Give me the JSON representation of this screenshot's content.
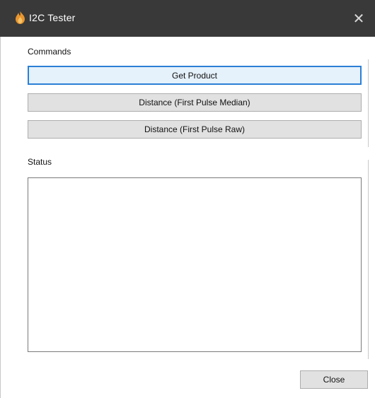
{
  "window": {
    "title": "I2C Tester",
    "close_glyph": "✕",
    "icon": "orange-flame-icon",
    "titlebar_color": "#393939"
  },
  "commands": {
    "label": "Commands",
    "buttons": [
      {
        "label": "Get Product"
      },
      {
        "label": "Distance (First Pulse Median)"
      },
      {
        "label": "Distance (First Pulse Raw)"
      }
    ],
    "focused_index": 0
  },
  "status": {
    "label": "Status",
    "text": ""
  },
  "footer": {
    "close_label": "Close"
  },
  "colors": {
    "focus_border": "#2b7fd6",
    "button_face": "#e1e1e1"
  }
}
